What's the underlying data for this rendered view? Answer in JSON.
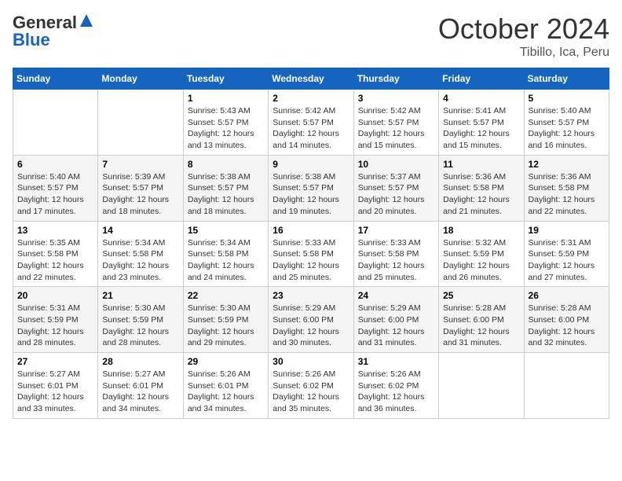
{
  "header": {
    "logo_general": "General",
    "logo_blue": "Blue",
    "month_title": "October 2024",
    "location": "Tibillo, Ica, Peru"
  },
  "days_of_week": [
    "Sunday",
    "Monday",
    "Tuesday",
    "Wednesday",
    "Thursday",
    "Friday",
    "Saturday"
  ],
  "weeks": [
    [
      {
        "day": "",
        "info": ""
      },
      {
        "day": "",
        "info": ""
      },
      {
        "day": "1",
        "sunrise": "Sunrise: 5:43 AM",
        "sunset": "Sunset: 5:57 PM",
        "daylight": "Daylight: 12 hours and 13 minutes."
      },
      {
        "day": "2",
        "sunrise": "Sunrise: 5:42 AM",
        "sunset": "Sunset: 5:57 PM",
        "daylight": "Daylight: 12 hours and 14 minutes."
      },
      {
        "day": "3",
        "sunrise": "Sunrise: 5:42 AM",
        "sunset": "Sunset: 5:57 PM",
        "daylight": "Daylight: 12 hours and 15 minutes."
      },
      {
        "day": "4",
        "sunrise": "Sunrise: 5:41 AM",
        "sunset": "Sunset: 5:57 PM",
        "daylight": "Daylight: 12 hours and 15 minutes."
      },
      {
        "day": "5",
        "sunrise": "Sunrise: 5:40 AM",
        "sunset": "Sunset: 5:57 PM",
        "daylight": "Daylight: 12 hours and 16 minutes."
      }
    ],
    [
      {
        "day": "6",
        "sunrise": "Sunrise: 5:40 AM",
        "sunset": "Sunset: 5:57 PM",
        "daylight": "Daylight: 12 hours and 17 minutes."
      },
      {
        "day": "7",
        "sunrise": "Sunrise: 5:39 AM",
        "sunset": "Sunset: 5:57 PM",
        "daylight": "Daylight: 12 hours and 18 minutes."
      },
      {
        "day": "8",
        "sunrise": "Sunrise: 5:38 AM",
        "sunset": "Sunset: 5:57 PM",
        "daylight": "Daylight: 12 hours and 18 minutes."
      },
      {
        "day": "9",
        "sunrise": "Sunrise: 5:38 AM",
        "sunset": "Sunset: 5:57 PM",
        "daylight": "Daylight: 12 hours and 19 minutes."
      },
      {
        "day": "10",
        "sunrise": "Sunrise: 5:37 AM",
        "sunset": "Sunset: 5:57 PM",
        "daylight": "Daylight: 12 hours and 20 minutes."
      },
      {
        "day": "11",
        "sunrise": "Sunrise: 5:36 AM",
        "sunset": "Sunset: 5:58 PM",
        "daylight": "Daylight: 12 hours and 21 minutes."
      },
      {
        "day": "12",
        "sunrise": "Sunrise: 5:36 AM",
        "sunset": "Sunset: 5:58 PM",
        "daylight": "Daylight: 12 hours and 22 minutes."
      }
    ],
    [
      {
        "day": "13",
        "sunrise": "Sunrise: 5:35 AM",
        "sunset": "Sunset: 5:58 PM",
        "daylight": "Daylight: 12 hours and 22 minutes."
      },
      {
        "day": "14",
        "sunrise": "Sunrise: 5:34 AM",
        "sunset": "Sunset: 5:58 PM",
        "daylight": "Daylight: 12 hours and 23 minutes."
      },
      {
        "day": "15",
        "sunrise": "Sunrise: 5:34 AM",
        "sunset": "Sunset: 5:58 PM",
        "daylight": "Daylight: 12 hours and 24 minutes."
      },
      {
        "day": "16",
        "sunrise": "Sunrise: 5:33 AM",
        "sunset": "Sunset: 5:58 PM",
        "daylight": "Daylight: 12 hours and 25 minutes."
      },
      {
        "day": "17",
        "sunrise": "Sunrise: 5:33 AM",
        "sunset": "Sunset: 5:58 PM",
        "daylight": "Daylight: 12 hours and 25 minutes."
      },
      {
        "day": "18",
        "sunrise": "Sunrise: 5:32 AM",
        "sunset": "Sunset: 5:59 PM",
        "daylight": "Daylight: 12 hours and 26 minutes."
      },
      {
        "day": "19",
        "sunrise": "Sunrise: 5:31 AM",
        "sunset": "Sunset: 5:59 PM",
        "daylight": "Daylight: 12 hours and 27 minutes."
      }
    ],
    [
      {
        "day": "20",
        "sunrise": "Sunrise: 5:31 AM",
        "sunset": "Sunset: 5:59 PM",
        "daylight": "Daylight: 12 hours and 28 minutes."
      },
      {
        "day": "21",
        "sunrise": "Sunrise: 5:30 AM",
        "sunset": "Sunset: 5:59 PM",
        "daylight": "Daylight: 12 hours and 28 minutes."
      },
      {
        "day": "22",
        "sunrise": "Sunrise: 5:30 AM",
        "sunset": "Sunset: 5:59 PM",
        "daylight": "Daylight: 12 hours and 29 minutes."
      },
      {
        "day": "23",
        "sunrise": "Sunrise: 5:29 AM",
        "sunset": "Sunset: 6:00 PM",
        "daylight": "Daylight: 12 hours and 30 minutes."
      },
      {
        "day": "24",
        "sunrise": "Sunrise: 5:29 AM",
        "sunset": "Sunset: 6:00 PM",
        "daylight": "Daylight: 12 hours and 31 minutes."
      },
      {
        "day": "25",
        "sunrise": "Sunrise: 5:28 AM",
        "sunset": "Sunset: 6:00 PM",
        "daylight": "Daylight: 12 hours and 31 minutes."
      },
      {
        "day": "26",
        "sunrise": "Sunrise: 5:28 AM",
        "sunset": "Sunset: 6:00 PM",
        "daylight": "Daylight: 12 hours and 32 minutes."
      }
    ],
    [
      {
        "day": "27",
        "sunrise": "Sunrise: 5:27 AM",
        "sunset": "Sunset: 6:01 PM",
        "daylight": "Daylight: 12 hours and 33 minutes."
      },
      {
        "day": "28",
        "sunrise": "Sunrise: 5:27 AM",
        "sunset": "Sunset: 6:01 PM",
        "daylight": "Daylight: 12 hours and 34 minutes."
      },
      {
        "day": "29",
        "sunrise": "Sunrise: 5:26 AM",
        "sunset": "Sunset: 6:01 PM",
        "daylight": "Daylight: 12 hours and 34 minutes."
      },
      {
        "day": "30",
        "sunrise": "Sunrise: 5:26 AM",
        "sunset": "Sunset: 6:02 PM",
        "daylight": "Daylight: 12 hours and 35 minutes."
      },
      {
        "day": "31",
        "sunrise": "Sunrise: 5:26 AM",
        "sunset": "Sunset: 6:02 PM",
        "daylight": "Daylight: 12 hours and 36 minutes."
      },
      {
        "day": "",
        "info": ""
      },
      {
        "day": "",
        "info": ""
      }
    ]
  ]
}
